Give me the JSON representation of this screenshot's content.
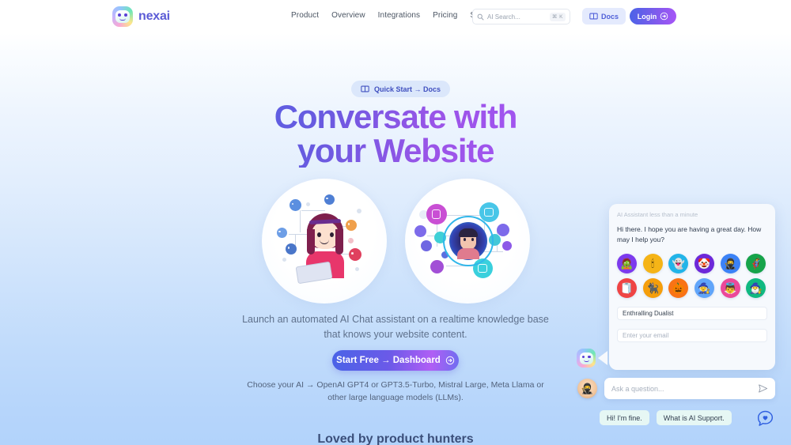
{
  "brand": {
    "name": "nexai",
    "logo_icon": "nexai-bot-logo-icon"
  },
  "nav": {
    "links": [
      {
        "label": "Product"
      },
      {
        "label": "Overview"
      },
      {
        "label": "Integrations"
      },
      {
        "label": "Pricing"
      },
      {
        "label": "Support"
      }
    ],
    "search": {
      "placeholder": "AI Search...",
      "shortcut": "⌘ K",
      "icon": "search-icon"
    },
    "docs_button": {
      "label": "Docs",
      "icon": "book-icon"
    },
    "login_button": {
      "label": "Login",
      "icon": "arrow-right-circle-icon"
    }
  },
  "hero": {
    "pill": {
      "label": "Quick Start → Docs",
      "icon": "book-icon"
    },
    "headline_line1": "Conversate with",
    "headline_line2": "your Website",
    "subtitle": "Launch an automated AI Chat assistant on a realtime knowledge base that knows your website content.",
    "cta": {
      "label": "Start Free → Dashboard",
      "icon": "arrow-right-circle-icon"
    },
    "models": "Choose your AI → OpenAI GPT4 or GPT3.5-Turbo, Mistral Large, Meta Llama or other large language models (LLMs).",
    "illustration_left": "girl-with-laptop-ai-network-illustration",
    "illustration_right": "ai-avatar-network-hub-illustration"
  },
  "social_proof": {
    "heading": "Loved by product hunters"
  },
  "chat": {
    "meta": "AI Assistant less than a minute",
    "greeting": "Hi there. I hope you are having a great day. How may I help you?",
    "avatars": [
      {
        "name": "avatar-zombie",
        "glyph": "🧟",
        "color": "#7c3aed"
      },
      {
        "name": "avatar-candle",
        "glyph": "🕯",
        "color": "#f5b417"
      },
      {
        "name": "avatar-ghost",
        "glyph": "👻",
        "color": "#22b4e8"
      },
      {
        "name": "avatar-clown",
        "glyph": "🤡",
        "color": "#6d28d9"
      },
      {
        "name": "avatar-ninja",
        "glyph": "🥷",
        "color": "#3b82f6"
      },
      {
        "name": "avatar-superhero",
        "glyph": "🦸",
        "color": "#16a34a"
      },
      {
        "name": "avatar-mummy",
        "glyph": "🧻",
        "color": "#ef4444"
      },
      {
        "name": "avatar-black-cat",
        "glyph": "🐈‍⬛",
        "color": "#f59e0b"
      },
      {
        "name": "avatar-pumpkin",
        "glyph": "🎃",
        "color": "#f97316"
      },
      {
        "name": "avatar-witch",
        "glyph": "🧙",
        "color": "#60a5fa"
      },
      {
        "name": "avatar-angel",
        "glyph": "👼",
        "color": "#ec4899"
      },
      {
        "name": "avatar-wizard",
        "glyph": "🧙‍♂️",
        "color": "#10b981"
      }
    ],
    "name_field": {
      "value": "Enthralling Dualist"
    },
    "email_field": {
      "placeholder": "Enter your email"
    },
    "ask_input": {
      "placeholder": "Ask a question...",
      "send_icon": "send-icon"
    },
    "ask_avatar": {
      "glyph": "🥷"
    },
    "bot_avatar": "nexai-bot-avatar-icon",
    "quick_replies": [
      {
        "label": "Hi! I'm fine."
      },
      {
        "label": "What is AI Support."
      }
    ],
    "launcher_icon": "chat-heart-icon"
  }
}
